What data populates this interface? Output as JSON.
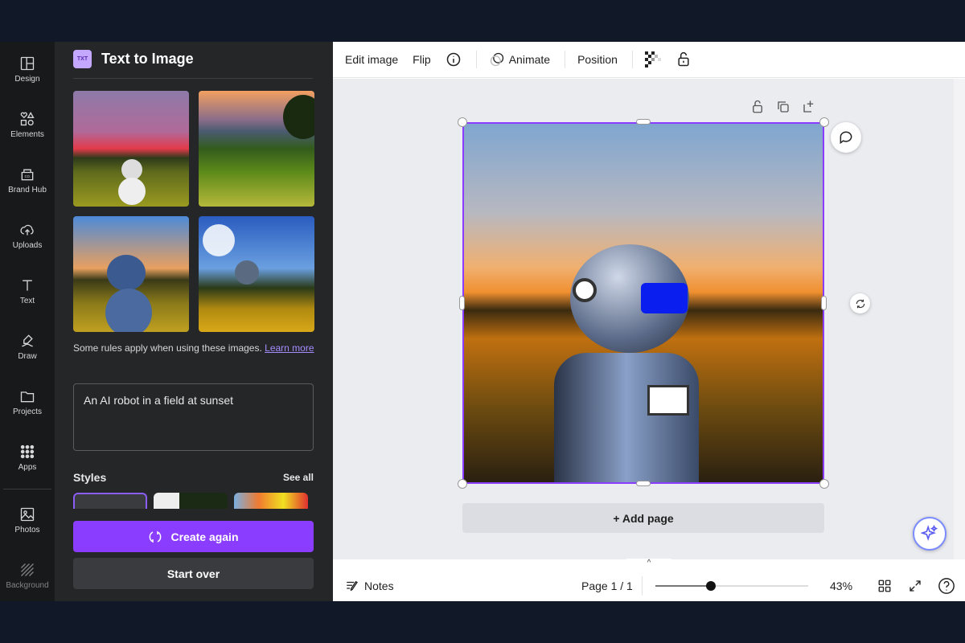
{
  "rail": [
    {
      "label": "Design",
      "icon": "layout-icon"
    },
    {
      "label": "Elements",
      "icon": "shapes-icon"
    },
    {
      "label": "Brand Hub",
      "icon": "brand-icon"
    },
    {
      "label": "Uploads",
      "icon": "cloud-upload-icon"
    },
    {
      "label": "Text",
      "icon": "text-icon"
    },
    {
      "label": "Draw",
      "icon": "pen-icon"
    },
    {
      "label": "Projects",
      "icon": "folder-icon"
    },
    {
      "label": "Apps",
      "icon": "grid-icon"
    },
    {
      "label": "Photos",
      "icon": "image-icon"
    },
    {
      "label": "Background",
      "icon": "hatch-icon"
    }
  ],
  "panel": {
    "title": "Text to Image",
    "rules_text": "Some rules apply when using these images. ",
    "learn_more": "Learn more",
    "prompt": "An AI robot in a field at sunset",
    "styles_label": "Styles",
    "see_all": "See all",
    "create_again": "Create again",
    "start_over": "Start over"
  },
  "toolbar": {
    "edit_image": "Edit image",
    "flip": "Flip",
    "animate": "Animate",
    "position": "Position"
  },
  "canvas": {
    "add_page": "+ Add page"
  },
  "footer": {
    "notes": "Notes",
    "page": "Page 1 / 1",
    "zoom": "43%",
    "zoom_value": 43
  },
  "colors": {
    "accent": "#8b3dff",
    "panel_bg": "#252627",
    "rail_bg": "#18191b"
  }
}
